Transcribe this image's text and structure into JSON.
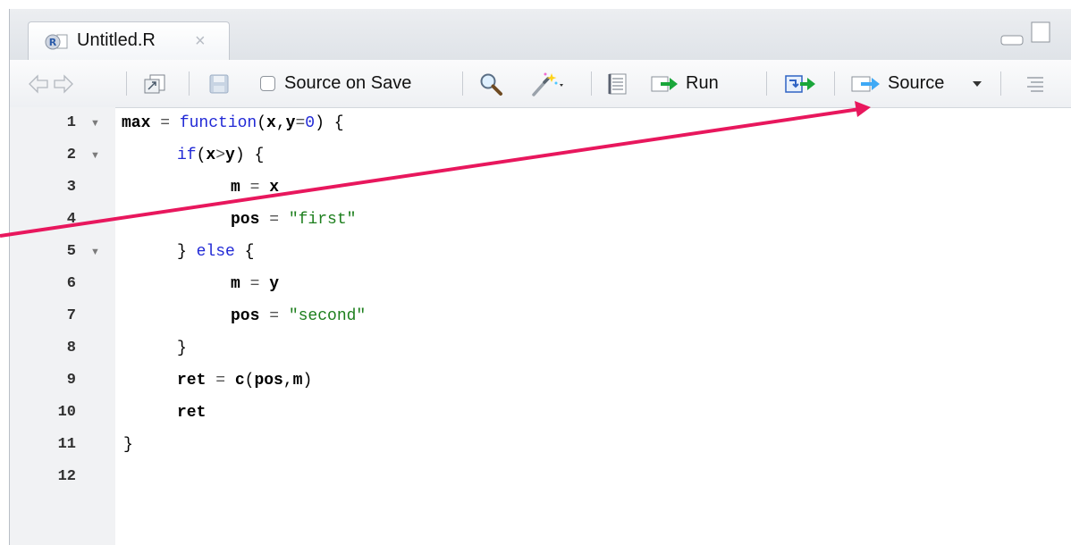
{
  "tab": {
    "title": "Untitled.R",
    "close": "×"
  },
  "toolbar": {
    "source_on_save": "Source on Save",
    "run": "Run",
    "source": "Source"
  },
  "line_numbers": [
    "1",
    "2",
    "3",
    "4",
    "5",
    "6",
    "7",
    "8",
    "9",
    "10",
    "11",
    "12"
  ],
  "code": {
    "l1": {
      "a": "max",
      "b": " = ",
      "c": "function",
      "d": "(",
      "e": "x",
      "f": ",",
      "g": "y",
      "h": "=",
      "i": "0",
      "j": ") {"
    },
    "l2": {
      "a": "if",
      "b": "(",
      "c": "x",
      "d": ">",
      "e": "y",
      "f": ") {"
    },
    "l3": {
      "a": "m",
      "b": " = ",
      "c": "x"
    },
    "l4": {
      "a": "pos",
      "b": " = ",
      "c": "\"first\""
    },
    "l5": {
      "a": "} ",
      "b": "else",
      "c": " {"
    },
    "l6": {
      "a": "m",
      "b": " = ",
      "c": "y"
    },
    "l7": {
      "a": "pos",
      "b": " = ",
      "c": "\"second\""
    },
    "l8": {
      "a": "}"
    },
    "l9": {
      "a": "ret",
      "b": " = ",
      "c": "c",
      "d": "(",
      "e": "pos",
      "f": ",",
      "g": "m",
      "h": ")"
    },
    "l10": {
      "a": "ret"
    },
    "l11": {
      "a": "}"
    }
  },
  "colors": {
    "keyword": "#2129d6",
    "string": "#1d7f1d",
    "annotation_arrow": "#e8175d",
    "run_arrow": "#1aa63a"
  },
  "icons": [
    "r-file-icon",
    "back-arrow-icon",
    "forward-arrow-icon",
    "show-in-window-icon",
    "save-icon",
    "search-icon",
    "magic-wand-icon",
    "compile-notebook-icon",
    "run-icon",
    "rerun-icon",
    "source-icon",
    "outline-icon"
  ]
}
